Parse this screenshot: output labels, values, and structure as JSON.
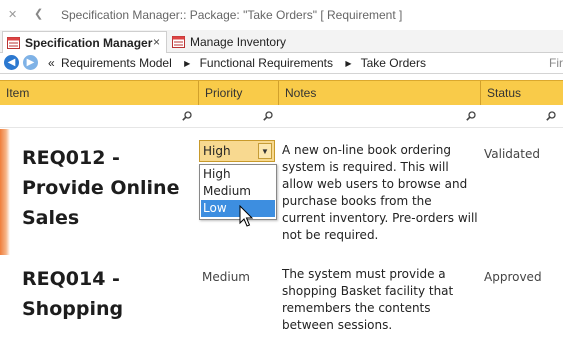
{
  "window": {
    "title": "Specification Manager::  Package: \"Take Orders\"  [ Requirement ]"
  },
  "tabs": [
    {
      "label": "Specification Manager",
      "close": "×"
    },
    {
      "label": "Manage Inventory"
    }
  ],
  "navbar": {
    "back": "◀",
    "forward": "▶",
    "breadcrumbs": [
      "«",
      "Requirements Model",
      "Functional Requirements",
      "Take Orders"
    ],
    "find_label": "Fir"
  },
  "grid": {
    "columns": [
      "Item",
      "Priority",
      "Notes",
      "Status"
    ],
    "rows": [
      {
        "item": "REQ012 - Provide Online Sales",
        "priority": "High",
        "notes": "A new on-line book ordering system is required. This will allow web users to browse and purchase books from the current inventory. Pre-orders will not be required.",
        "status": "Validated"
      },
      {
        "item": "REQ014 - Shopping",
        "priority": "Medium",
        "notes": "The system must provide a shopping Basket facility that remembers the contents between sessions.",
        "status": "Approved"
      }
    ]
  },
  "priority_dropdown": {
    "value": "High",
    "options": [
      "High",
      "Medium",
      "Low"
    ],
    "highlighted": "Low"
  },
  "colors": {
    "header_bg": "#f9cb49",
    "selected_option": "#3d8ee0",
    "row_accent": "#ef7d3b"
  }
}
